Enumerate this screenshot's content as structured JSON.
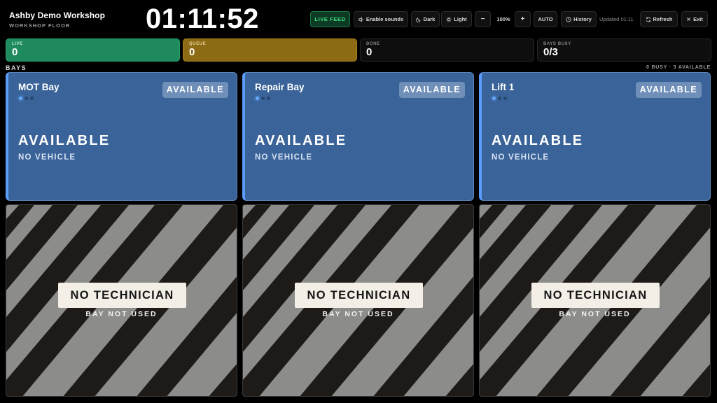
{
  "header": {
    "title": "Ashby Demo Workshop",
    "subtitle": "WORKSHOP FLOOR",
    "clock": "01:11:52"
  },
  "toolbar": {
    "live_feed": "LIVE FEED",
    "enable_sounds": "Enable sounds",
    "dark": "Dark",
    "light": "Light",
    "zoom_out": "−",
    "zoom_value": "100%",
    "zoom_in": "+",
    "auto": "AUTO",
    "history": "History",
    "updated": "Updated 01:11",
    "refresh": "Refresh",
    "exit": "Exit"
  },
  "stats": {
    "live": {
      "label": "LIVE",
      "value": "0"
    },
    "queue": {
      "label": "QUEUE",
      "value": "0"
    },
    "done": {
      "label": "DONE",
      "value": "0"
    },
    "bays_busy": {
      "label": "BAYS BUSY",
      "value": "0/3"
    }
  },
  "section": {
    "title": "BAYS",
    "summary": "0 BUSY · 3 AVAILABLE"
  },
  "bays": [
    {
      "name": "MOT Bay",
      "badge": "AVAILABLE",
      "status": "AVAILABLE",
      "vehicle": "NO VEHICLE"
    },
    {
      "name": "Repair Bay",
      "badge": "AVAILABLE",
      "status": "AVAILABLE",
      "vehicle": "NO VEHICLE"
    },
    {
      "name": "Lift 1",
      "badge": "AVAILABLE",
      "status": "AVAILABLE",
      "vehicle": "NO VEHICLE"
    }
  ],
  "technicians": [
    {
      "label": "NO TECHNICIAN",
      "sub": "BAY NOT USED"
    },
    {
      "label": "NO TECHNICIAN",
      "sub": "BAY NOT USED"
    },
    {
      "label": "NO TECHNICIAN",
      "sub": "BAY NOT USED"
    }
  ],
  "colors": {
    "background": "#000000",
    "live_accent": "#1e8a5e",
    "queue_accent": "#8d6a14",
    "bay_card": "#3a6399",
    "bay_accent": "#5b9cff",
    "live_feed_text": "#3ee08a"
  },
  "icons": {
    "enable_sounds": "speaker-icon",
    "dark": "moon-icon",
    "light": "sun-icon",
    "history": "clock-icon",
    "refresh": "refresh-icon",
    "exit": "close-icon"
  }
}
